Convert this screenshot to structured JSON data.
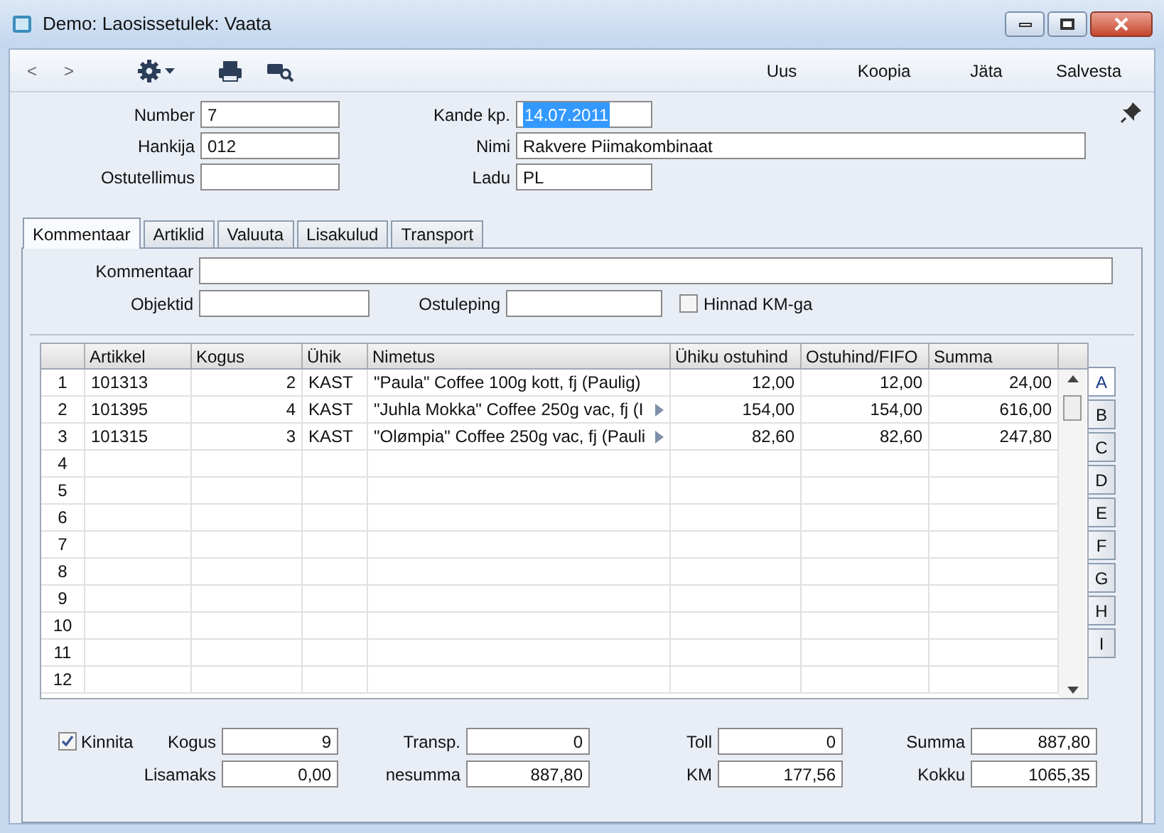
{
  "window": {
    "title": "Demo: Laosissetulek: Vaata"
  },
  "toolbar": {
    "nav": [
      "<",
      ">"
    ],
    "actions": [
      "Uus",
      "Koopia",
      "Jäta",
      "Salvesta"
    ]
  },
  "header": {
    "left": [
      {
        "label": "Number",
        "value": "7"
      },
      {
        "label": "Hankija",
        "value": "012"
      },
      {
        "label": "Ostutellimus"
      }
    ],
    "right": [
      {
        "label": "Kande kp.",
        "value": "14.07.2011",
        "selected": true,
        "wide": false
      },
      {
        "label": "Nimi",
        "value": "Rakvere Piimakombinaat",
        "selected": false,
        "wide": true
      },
      {
        "label": "Ladu",
        "value": "PL",
        "selected": false,
        "wide": false
      }
    ]
  },
  "tabs": [
    {
      "label": "Kommentaar",
      "selected": true
    },
    {
      "label": "Artiklid",
      "selected": false
    },
    {
      "label": "Valuuta",
      "selected": false
    },
    {
      "label": "Lisakulud",
      "selected": false
    },
    {
      "label": "Transport",
      "selected": false
    }
  ],
  "comment": {
    "label": "Kommentaar",
    "objektid": "Objektid",
    "ostuleping": "Ostuleping",
    "prices_with_vat": {
      "label": "Hinnad KM-ga",
      "checked": false
    }
  },
  "table": {
    "columns": [
      "Artikkel",
      "Kogus",
      "Ühik",
      "Nimetus",
      "Ühiku ostuhind",
      "Ostuhind/FIFO",
      "Summa"
    ],
    "rows": [
      {
        "row": "1",
        "cells": [
          "101313",
          "2",
          "KAST",
          "\"Paula\" Coffee 100g kott, fj  (Paulig)",
          "12,00",
          "12,00",
          "24,00"
        ],
        "overflow": false
      },
      {
        "row": "2",
        "cells": [
          "101395",
          "4",
          "KAST",
          "\"Juhla Mokka\" Coffee 250g vac, fj  (I",
          "154,00",
          "154,00",
          "616,00"
        ],
        "overflow": true
      },
      {
        "row": "3",
        "cells": [
          "101315",
          "3",
          "KAST",
          "\"Olømpia\" Coffee 250g vac, fj  (Pauli",
          "82,60",
          "82,60",
          "247,80"
        ],
        "overflow": true
      },
      {
        "row": "4"
      },
      {
        "row": "5"
      },
      {
        "row": "6"
      },
      {
        "row": "7"
      },
      {
        "row": "8"
      },
      {
        "row": "9"
      },
      {
        "row": "10"
      },
      {
        "row": "11"
      },
      {
        "row": "12"
      }
    ]
  },
  "side_tabs": [
    {
      "label": "A",
      "selected": true
    },
    {
      "label": "B",
      "selected": false
    },
    {
      "label": "C",
      "selected": false
    },
    {
      "label": "D",
      "selected": false
    },
    {
      "label": "E",
      "selected": false
    },
    {
      "label": "F",
      "selected": false
    },
    {
      "label": "G",
      "selected": false
    },
    {
      "label": "H",
      "selected": false
    },
    {
      "label": "I",
      "selected": false
    }
  ],
  "totals": {
    "kinnita": {
      "label": "Kinnita",
      "checked": true
    },
    "row1": [
      {
        "label": "Kogus",
        "value": "9"
      },
      {
        "label": "Transp.",
        "value": "0"
      },
      {
        "label": "Toll",
        "value": "0"
      },
      {
        "label": "Summa",
        "value": "887,80"
      }
    ],
    "row2": [
      {
        "label": "Lisamaks",
        "value": "0,00"
      },
      {
        "label": "nesumma",
        "value": "887,80"
      },
      {
        "label": "KM",
        "value": "177,56"
      },
      {
        "label": "Kokku",
        "value": "1065,35"
      }
    ]
  }
}
